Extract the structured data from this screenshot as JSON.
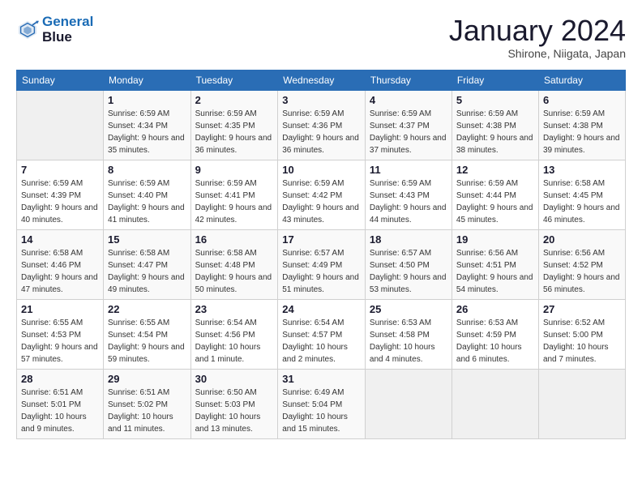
{
  "header": {
    "logo_line1": "General",
    "logo_line2": "Blue",
    "month": "January 2024",
    "location": "Shirone, Niigata, Japan"
  },
  "days_of_week": [
    "Sunday",
    "Monday",
    "Tuesday",
    "Wednesday",
    "Thursday",
    "Friday",
    "Saturday"
  ],
  "weeks": [
    [
      {
        "day": "",
        "sunrise": "",
        "sunset": "",
        "daylight": ""
      },
      {
        "day": "1",
        "sunrise": "Sunrise: 6:59 AM",
        "sunset": "Sunset: 4:34 PM",
        "daylight": "Daylight: 9 hours and 35 minutes."
      },
      {
        "day": "2",
        "sunrise": "Sunrise: 6:59 AM",
        "sunset": "Sunset: 4:35 PM",
        "daylight": "Daylight: 9 hours and 36 minutes."
      },
      {
        "day": "3",
        "sunrise": "Sunrise: 6:59 AM",
        "sunset": "Sunset: 4:36 PM",
        "daylight": "Daylight: 9 hours and 36 minutes."
      },
      {
        "day": "4",
        "sunrise": "Sunrise: 6:59 AM",
        "sunset": "Sunset: 4:37 PM",
        "daylight": "Daylight: 9 hours and 37 minutes."
      },
      {
        "day": "5",
        "sunrise": "Sunrise: 6:59 AM",
        "sunset": "Sunset: 4:38 PM",
        "daylight": "Daylight: 9 hours and 38 minutes."
      },
      {
        "day": "6",
        "sunrise": "Sunrise: 6:59 AM",
        "sunset": "Sunset: 4:38 PM",
        "daylight": "Daylight: 9 hours and 39 minutes."
      }
    ],
    [
      {
        "day": "7",
        "sunrise": "Sunrise: 6:59 AM",
        "sunset": "Sunset: 4:39 PM",
        "daylight": "Daylight: 9 hours and 40 minutes."
      },
      {
        "day": "8",
        "sunrise": "Sunrise: 6:59 AM",
        "sunset": "Sunset: 4:40 PM",
        "daylight": "Daylight: 9 hours and 41 minutes."
      },
      {
        "day": "9",
        "sunrise": "Sunrise: 6:59 AM",
        "sunset": "Sunset: 4:41 PM",
        "daylight": "Daylight: 9 hours and 42 minutes."
      },
      {
        "day": "10",
        "sunrise": "Sunrise: 6:59 AM",
        "sunset": "Sunset: 4:42 PM",
        "daylight": "Daylight: 9 hours and 43 minutes."
      },
      {
        "day": "11",
        "sunrise": "Sunrise: 6:59 AM",
        "sunset": "Sunset: 4:43 PM",
        "daylight": "Daylight: 9 hours and 44 minutes."
      },
      {
        "day": "12",
        "sunrise": "Sunrise: 6:59 AM",
        "sunset": "Sunset: 4:44 PM",
        "daylight": "Daylight: 9 hours and 45 minutes."
      },
      {
        "day": "13",
        "sunrise": "Sunrise: 6:58 AM",
        "sunset": "Sunset: 4:45 PM",
        "daylight": "Daylight: 9 hours and 46 minutes."
      }
    ],
    [
      {
        "day": "14",
        "sunrise": "Sunrise: 6:58 AM",
        "sunset": "Sunset: 4:46 PM",
        "daylight": "Daylight: 9 hours and 47 minutes."
      },
      {
        "day": "15",
        "sunrise": "Sunrise: 6:58 AM",
        "sunset": "Sunset: 4:47 PM",
        "daylight": "Daylight: 9 hours and 49 minutes."
      },
      {
        "day": "16",
        "sunrise": "Sunrise: 6:58 AM",
        "sunset": "Sunset: 4:48 PM",
        "daylight": "Daylight: 9 hours and 50 minutes."
      },
      {
        "day": "17",
        "sunrise": "Sunrise: 6:57 AM",
        "sunset": "Sunset: 4:49 PM",
        "daylight": "Daylight: 9 hours and 51 minutes."
      },
      {
        "day": "18",
        "sunrise": "Sunrise: 6:57 AM",
        "sunset": "Sunset: 4:50 PM",
        "daylight": "Daylight: 9 hours and 53 minutes."
      },
      {
        "day": "19",
        "sunrise": "Sunrise: 6:56 AM",
        "sunset": "Sunset: 4:51 PM",
        "daylight": "Daylight: 9 hours and 54 minutes."
      },
      {
        "day": "20",
        "sunrise": "Sunrise: 6:56 AM",
        "sunset": "Sunset: 4:52 PM",
        "daylight": "Daylight: 9 hours and 56 minutes."
      }
    ],
    [
      {
        "day": "21",
        "sunrise": "Sunrise: 6:55 AM",
        "sunset": "Sunset: 4:53 PM",
        "daylight": "Daylight: 9 hours and 57 minutes."
      },
      {
        "day": "22",
        "sunrise": "Sunrise: 6:55 AM",
        "sunset": "Sunset: 4:54 PM",
        "daylight": "Daylight: 9 hours and 59 minutes."
      },
      {
        "day": "23",
        "sunrise": "Sunrise: 6:54 AM",
        "sunset": "Sunset: 4:56 PM",
        "daylight": "Daylight: 10 hours and 1 minute."
      },
      {
        "day": "24",
        "sunrise": "Sunrise: 6:54 AM",
        "sunset": "Sunset: 4:57 PM",
        "daylight": "Daylight: 10 hours and 2 minutes."
      },
      {
        "day": "25",
        "sunrise": "Sunrise: 6:53 AM",
        "sunset": "Sunset: 4:58 PM",
        "daylight": "Daylight: 10 hours and 4 minutes."
      },
      {
        "day": "26",
        "sunrise": "Sunrise: 6:53 AM",
        "sunset": "Sunset: 4:59 PM",
        "daylight": "Daylight: 10 hours and 6 minutes."
      },
      {
        "day": "27",
        "sunrise": "Sunrise: 6:52 AM",
        "sunset": "Sunset: 5:00 PM",
        "daylight": "Daylight: 10 hours and 7 minutes."
      }
    ],
    [
      {
        "day": "28",
        "sunrise": "Sunrise: 6:51 AM",
        "sunset": "Sunset: 5:01 PM",
        "daylight": "Daylight: 10 hours and 9 minutes."
      },
      {
        "day": "29",
        "sunrise": "Sunrise: 6:51 AM",
        "sunset": "Sunset: 5:02 PM",
        "daylight": "Daylight: 10 hours and 11 minutes."
      },
      {
        "day": "30",
        "sunrise": "Sunrise: 6:50 AM",
        "sunset": "Sunset: 5:03 PM",
        "daylight": "Daylight: 10 hours and 13 minutes."
      },
      {
        "day": "31",
        "sunrise": "Sunrise: 6:49 AM",
        "sunset": "Sunset: 5:04 PM",
        "daylight": "Daylight: 10 hours and 15 minutes."
      },
      {
        "day": "",
        "sunrise": "",
        "sunset": "",
        "daylight": ""
      },
      {
        "day": "",
        "sunrise": "",
        "sunset": "",
        "daylight": ""
      },
      {
        "day": "",
        "sunrise": "",
        "sunset": "",
        "daylight": ""
      }
    ]
  ]
}
